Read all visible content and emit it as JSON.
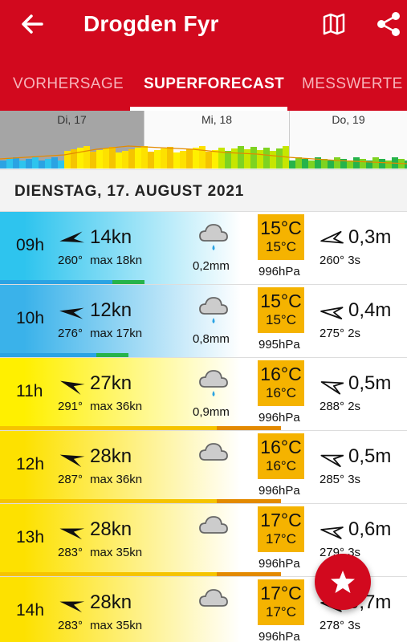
{
  "header": {
    "title": "Drogden Fyr",
    "back_icon": "arrow-left-icon",
    "map_icon": "map-icon",
    "share_icon": "share-icon",
    "bg_color": "#d2091e"
  },
  "tabs": [
    {
      "label": "VORHERSAGE",
      "active": false
    },
    {
      "label": "SUPERFORECAST",
      "active": true
    },
    {
      "label": "MESSWERTE",
      "active": false
    }
  ],
  "timeline": {
    "days": [
      "Di, 17",
      "Mi, 18",
      "Do, 19"
    ]
  },
  "date_header": "DIENSTAG, 17. AUGUST 2021",
  "rows": [
    {
      "hour": "09h",
      "speed": "14",
      "unit": "kn",
      "dir": "260°",
      "max": "max 18kn",
      "rain": "0,2mm",
      "temp": "15°C",
      "temp2": "15°C",
      "pressure": "996hPa",
      "wave": "0,3",
      "wave_unit": "m",
      "wave_dir": "260° 3s",
      "wind_color": "#2ec4ee",
      "wind_angle": 260,
      "wave_angle": 260,
      "drops": 1
    },
    {
      "hour": "10h",
      "speed": "12",
      "unit": "kn",
      "dir": "276°",
      "max": "max 17kn",
      "rain": "0,8mm",
      "temp": "15°C",
      "temp2": "15°C",
      "pressure": "995hPa",
      "wave": "0,4",
      "wave_unit": "m",
      "wave_dir": "275° 2s",
      "wind_color": "#3ab2ea",
      "wind_angle": 276,
      "wave_angle": 275,
      "drops": 1
    },
    {
      "hour": "11h",
      "speed": "27",
      "unit": "kn",
      "dir": "291°",
      "max": "max 36kn",
      "rain": "0,9mm",
      "temp": "16°C",
      "temp2": "16°C",
      "pressure": "996hPa",
      "wave": "0,5",
      "wave_unit": "m",
      "wave_dir": "288° 2s",
      "wind_color": "#fff000",
      "wind_angle": 291,
      "wave_angle": 288,
      "drops": 1
    },
    {
      "hour": "12h",
      "speed": "28",
      "unit": "kn",
      "dir": "287°",
      "max": "max 36kn",
      "rain": "",
      "temp": "16°C",
      "temp2": "16°C",
      "pressure": "996hPa",
      "wave": "0,5",
      "wave_unit": "m",
      "wave_dir": "285° 3s",
      "wind_color": "#fde100",
      "wind_angle": 287,
      "wave_angle": 285,
      "drops": 0
    },
    {
      "hour": "13h",
      "speed": "28",
      "unit": "kn",
      "dir": "283°",
      "max": "max 35kn",
      "rain": "",
      "temp": "17°C",
      "temp2": "17°C",
      "pressure": "996hPa",
      "wave": "0,6",
      "wave_unit": "m",
      "wave_dir": "279° 3s",
      "wind_color": "#fde100",
      "wind_angle": 283,
      "wave_angle": 279,
      "drops": 0
    },
    {
      "hour": "14h",
      "speed": "28",
      "unit": "kn",
      "dir": "283°",
      "max": "max 35kn",
      "rain": "",
      "temp": "17°C",
      "temp2": "17°C",
      "pressure": "996hPa",
      "wave": "0,7",
      "wave_unit": "m",
      "wave_dir": "278° 3s",
      "wind_color": "#fde100",
      "wind_angle": 283,
      "wave_angle": 278,
      "drops": 0
    }
  ],
  "fab": {
    "icon": "star-icon"
  }
}
